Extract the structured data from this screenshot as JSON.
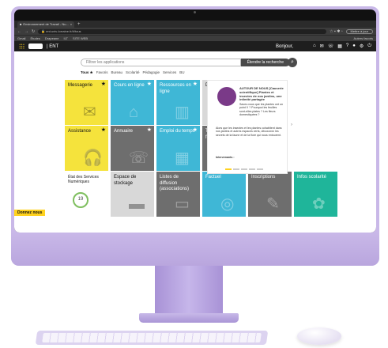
{
  "browser": {
    "tab_title": "Environnement de Travail - Nu...",
    "url": "ent.univ-lorraine.fr/#/tous",
    "profile_button": "Mettre à jour",
    "bookmarks": [
      "Gmail",
      "Études",
      "Drapeane",
      "ILT",
      "SITE WEB"
    ],
    "bookmarks_right": "Autres favoris"
  },
  "ent": {
    "brand": "| ENT",
    "greeting": "Bonjour,",
    "notification_count": "1"
  },
  "search": {
    "placeholder": "Filtrer les applications",
    "button": "Étendre la recherche"
  },
  "filters": [
    "Tous ★",
    "Favoris",
    "Bureau",
    "Scolarité",
    "Pédagogie",
    "Services",
    "BU"
  ],
  "tiles": [
    {
      "label": "Messagerie",
      "color": "#f5e33c",
      "text": "#111111",
      "star": true
    },
    {
      "label": "Cours en ligne",
      "color": "#3fb7d6",
      "text": "#ffffff",
      "star": true
    },
    {
      "label": "Ressources en ligne",
      "color": "#3fb7d6",
      "text": "#ffffff",
      "star": true
    },
    {
      "label": "Dossier étudiant",
      "color": "#d8d8d8",
      "text": "#111111",
      "star": true
    },
    {
      "label": "Assistance",
      "color": "#f5e33c",
      "text": "#111111",
      "star": true
    },
    {
      "label": "Annuaire",
      "color": "#6e6e6e",
      "text": "#ffffff",
      "star": true
    },
    {
      "label": "Emploi du temps",
      "color": "#3fb7d6",
      "text": "#ffffff",
      "star": true
    },
    {
      "label": "Transfert de fichier",
      "color": "#6e6e6e",
      "text": "#ffffff",
      "star": false
    },
    {
      "label": "Espace de stockage",
      "color": "#d8d8d8",
      "text": "#111111",
      "star": false
    },
    {
      "label": "Listes de diffusion (associations)",
      "color": "#6e6e6e",
      "text": "#ffffff",
      "star": false
    },
    {
      "label": "Factuel",
      "color": "#3fb7d6",
      "text": "#ffffff",
      "star": false
    },
    {
      "label": "Inscriptions",
      "color": "#6e6e6e",
      "text": "#ffffff",
      "star": false
    },
    {
      "label": "Infos scolarité",
      "color": "#1fb59a",
      "text": "#ffffff",
      "star": false
    }
  ],
  "status_tile": {
    "label": "État des Services Numériques",
    "value": "19"
  },
  "feedback_button": "Donnez nous",
  "news": {
    "title": "AUTOUR DE NOUS [Causerie scientifique] Plantes et insectes de nos jardins, une intimité partagée",
    "subtitle": "Savez-vous que les plantes ont un point V ? Pourquoi les feuilles sont-elles plates ? Les fleurs domestiquées ?",
    "body": "Alors que les insectes et les plantes cohabitent dans nos jardins et autres espaces verts, découvrez les secrets de la faune et de la flore qui nous entourent.",
    "speakers_label": "Intervenants :"
  }
}
